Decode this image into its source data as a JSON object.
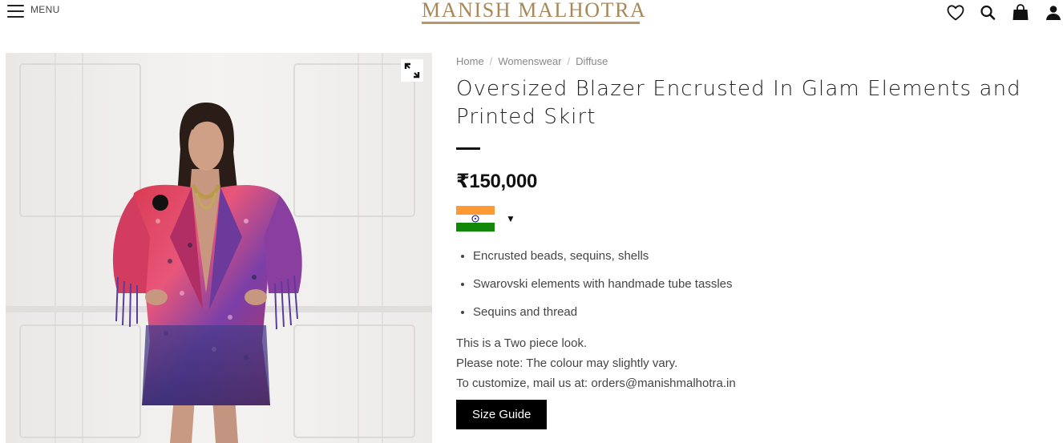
{
  "header": {
    "menu_label": "MENU",
    "logo_text": "MANISH MALHOTRA",
    "icons": [
      "heart-icon",
      "search-icon",
      "shopping-bag-icon",
      "user-icon"
    ]
  },
  "breadcrumb": [
    {
      "label": "Home"
    },
    {
      "label": "Womenswear"
    },
    {
      "label": "Diffuse"
    }
  ],
  "breadcrumb_separator": "/",
  "product": {
    "title_line1": "Oversized Blazer Encrusted In Glam Elements and",
    "title_line2": "Printed Skirt",
    "price": "₹150,000",
    "currency_flag": "india-flag",
    "currency_caret": "▼",
    "features": [
      "Encrusted beads, sequins, shells",
      "Swarovski elements with handmade tube tassles",
      "Sequins and thread"
    ],
    "notes": [
      "This is a Two piece look.",
      "Please note: The colour may slightly vary.",
      "To customize, mail us at: orders@manishmalhotra.in"
    ],
    "size_guide_label": "Size Guide"
  },
  "colors": {
    "logo_gold": "#a8875a",
    "button_bg": "#000000",
    "text": "#333333"
  }
}
